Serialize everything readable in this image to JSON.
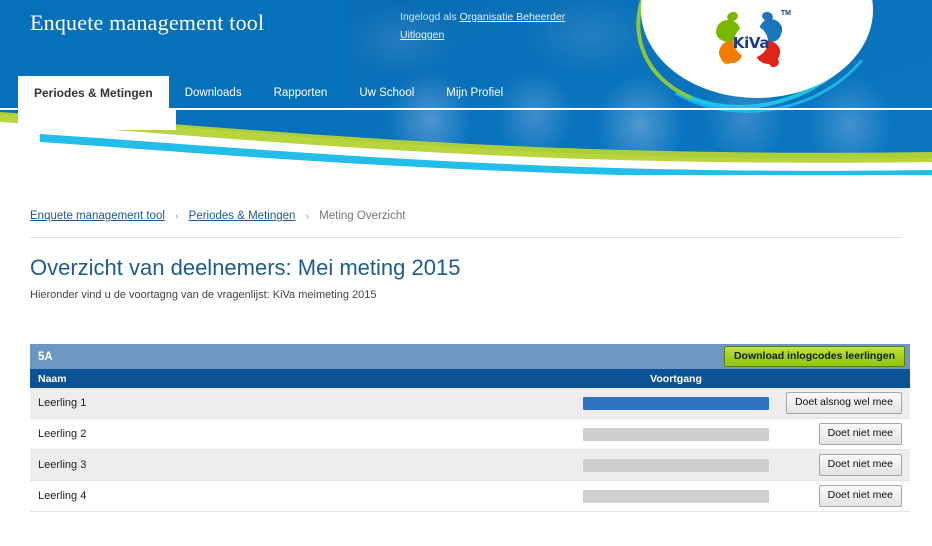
{
  "header": {
    "app_title": "Enquete management tool",
    "login_prefix": "Ingelogd als ",
    "login_user": "Organisatie Beheerder",
    "logout_label": "Uitloggen",
    "logo_word": "KiVa",
    "logo_tm": "TM"
  },
  "nav": {
    "tabs": [
      {
        "label": "Periodes & Metingen",
        "active": true
      },
      {
        "label": "Downloads",
        "active": false
      },
      {
        "label": "Rapporten",
        "active": false
      },
      {
        "label": "Uw School",
        "active": false
      },
      {
        "label": "Mijn Profiel",
        "active": false
      }
    ]
  },
  "breadcrumb": {
    "items": [
      {
        "label": "Enquete management tool",
        "link": true
      },
      {
        "label": "Periodes & Metingen",
        "link": true
      },
      {
        "label": "Meting Overzicht",
        "link": false
      }
    ],
    "separator": "›"
  },
  "page": {
    "title": "Overzicht van deelnemers: Mei meting 2015",
    "subtitle": "Hieronder vind u de voortagng van de vragenlijst: KiVa meimeting 2015"
  },
  "table": {
    "group_title": "5A",
    "download_button": "Download inlogcodes leerlingen",
    "columns": {
      "naam": "Naam",
      "voortgang": "Voortgang",
      "action": ""
    },
    "rows": [
      {
        "naam": "Leerling 1",
        "progress": 100,
        "action": "Doet alsnog wel mee"
      },
      {
        "naam": "Leerling 2",
        "progress": 0,
        "action": "Doet niet mee"
      },
      {
        "naam": "Leerling 3",
        "progress": 0,
        "action": "Doet niet mee"
      },
      {
        "naam": "Leerling 4",
        "progress": 0,
        "action": "Doet niet mee"
      }
    ]
  },
  "colors": {
    "banner_blue": "#0571b9",
    "nav_active_bg": "#ffffff",
    "group_header": "#6d96c0",
    "column_header": "#0b5394",
    "progress_fill": "#2f72c4",
    "progress_track": "#cfcfcf",
    "download_button_green": "#9fd017",
    "title_blue": "#1f5c8b",
    "row_alt": "#ededed",
    "swoosh_green": "#8cc63f",
    "swoosh_cyan": "#22bde8"
  }
}
